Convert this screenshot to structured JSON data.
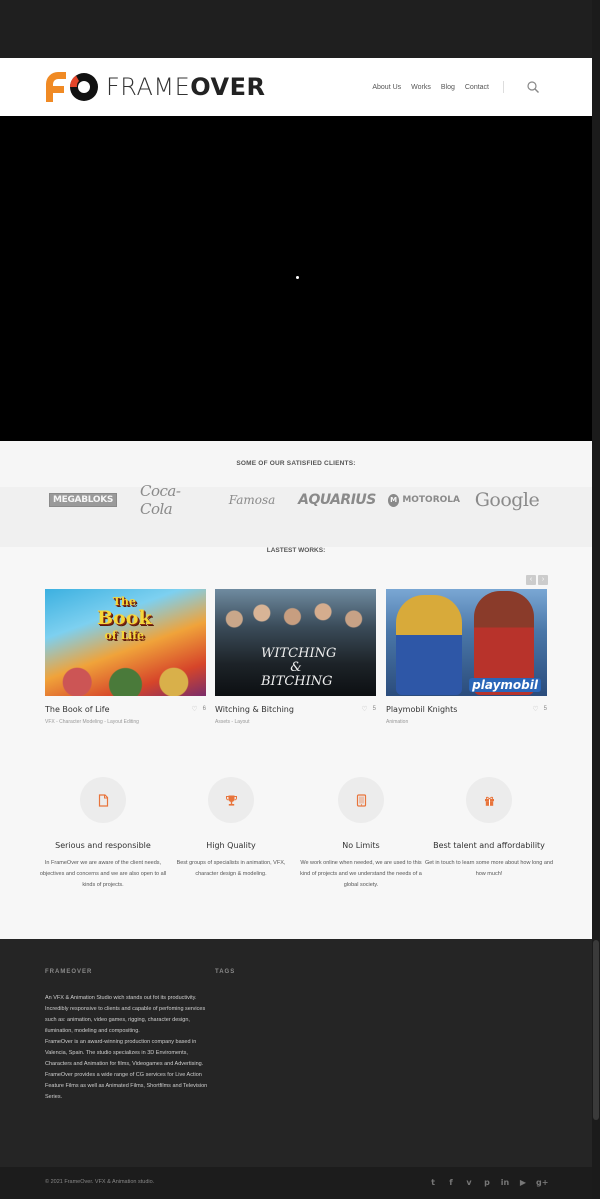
{
  "brand": {
    "name_light": "FRAME",
    "name_bold": "OVER",
    "logo_color": "#f08a24"
  },
  "nav": {
    "items": [
      {
        "label": "About Us"
      },
      {
        "label": "Works"
      },
      {
        "label": "Blog"
      },
      {
        "label": "Contact"
      }
    ],
    "search_icon": "search-icon"
  },
  "clients": {
    "title": "SOME OF OUR SATISFIED CLIENTS:",
    "logos": [
      "MEGABLOKS",
      "Coca-Cola",
      "Famosa",
      "AQUARIUS",
      "MOTOROLA",
      "Google"
    ]
  },
  "works": {
    "title": "LASTEST WORKS:",
    "prev_icon": "chevron-left-icon",
    "next_icon": "chevron-right-icon",
    "items": [
      {
        "title": "The Book of Life",
        "categories": "VFX - Character Modeling - Layout Editing",
        "likes": "6",
        "poster_title": "Book",
        "poster_small": "The",
        "poster_sub": "of Life"
      },
      {
        "title": "Witching & Bitching",
        "categories": "Assets - Layout",
        "likes": "5",
        "poster_title": "WITCHING & BITCHING"
      },
      {
        "title": "Playmobil Knights",
        "categories": "Animation",
        "likes": "5",
        "poster_title": "playmobil"
      }
    ]
  },
  "features": [
    {
      "icon": "document-icon",
      "title": "Serious and responsible",
      "text": "In FrameOver we are aware of the client needs, objectives and concerns and we are also open to all kinds of projects."
    },
    {
      "icon": "trophy-icon",
      "title": "High Quality",
      "text": "Best groups of specialists in animation, VFX, character design & modeling."
    },
    {
      "icon": "tablet-icon",
      "title": "No Limits",
      "text": "We work online when needed, we are used to this kind of projects and we understand the needs of a global society."
    },
    {
      "icon": "gift-icon",
      "title": "Best talent and affordability",
      "text": "Get in touch to learn some more about how long and how much!"
    }
  ],
  "footer": {
    "about_heading": "FRAMEOVER",
    "tags_heading": "TAGS",
    "about_p1": "An VFX & Animation Studio wich stands out fot its productivity. Incredibly responsive to clients and capable of perfoming services such as: animation, video games, rigging, character design, ilumination, modeling and compositing.",
    "about_p2": "FrameOver is an award-winning production company based in Valencia, Spain. The studio specializes in 3D Enviroments, Characters and Animation for films, Videogames and Advertising.",
    "about_p3": "FrameOver provides a wide range of CG services for Live Action Feature Films as well as Animated Films, Shortfilms and Television Series.",
    "copyright": "© 2021 FrameOver. VFX & Animation studio.",
    "socials": [
      "twitter-icon",
      "facebook-icon",
      "vimeo-icon",
      "pinterest-icon",
      "linkedin-icon",
      "youtube-icon",
      "google-plus-icon"
    ]
  }
}
